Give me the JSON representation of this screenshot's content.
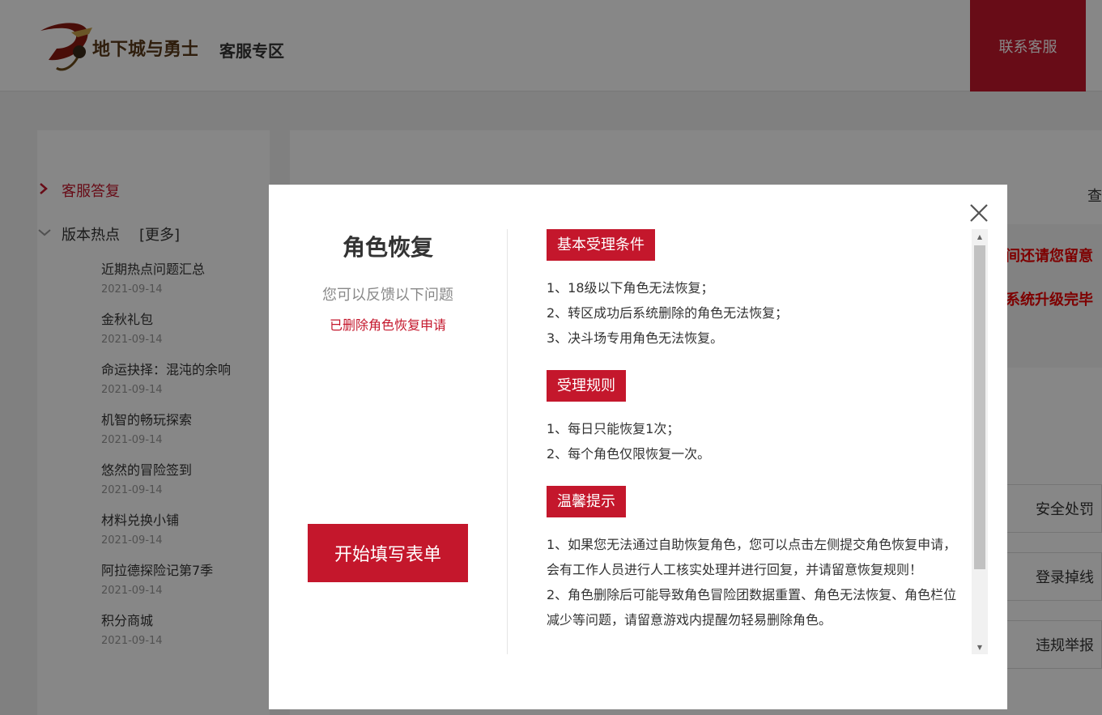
{
  "header": {
    "logo_text": "地下城与勇士",
    "site_title": "客服专区",
    "contact_label": "联系客服"
  },
  "sidebar": {
    "active_item": "客服答复",
    "hot_section": "版本热点",
    "more_label": "[更多]",
    "news": [
      {
        "title": "近期热点问题汇总",
        "date": "2021-09-14"
      },
      {
        "title": "金秋礼包",
        "date": "2021-09-14"
      },
      {
        "title": "命运抉择：混沌的余响",
        "date": "2021-09-14"
      },
      {
        "title": "机智的畅玩探索",
        "date": "2021-09-14"
      },
      {
        "title": "悠然的冒险签到",
        "date": "2021-09-14"
      },
      {
        "title": "材料兑换小铺",
        "date": "2021-09-14"
      },
      {
        "title": "阿拉德探险记第7季",
        "date": "2021-09-14"
      },
      {
        "title": "积分商城",
        "date": "2021-09-14"
      }
    ]
  },
  "background": {
    "search_peek": "查",
    "red_text_1": "间还请您留意",
    "red_text_2": "系统升级完毕",
    "categories": [
      "安全处罚",
      "登录掉线",
      "违规举报"
    ]
  },
  "modal": {
    "title": "角色恢复",
    "subtitle": "您可以反馈以下问题",
    "link": "已删除角色恢复申请",
    "start_button": "开始填写表单",
    "sections": [
      {
        "heading": "基本受理条件",
        "items": [
          "1、18级以下角色无法恢复；",
          "2、转区成功后系统删除的角色无法恢复；",
          "3、决斗场专用角色无法恢复。"
        ]
      },
      {
        "heading": "受理规则",
        "items": [
          "1、每日只能恢复1次；",
          "2、每个角色仅限恢复一次。"
        ]
      },
      {
        "heading": "温馨提示",
        "items": [
          "1、如果您无法通过自助恢复角色，您可以点击左侧提交角色恢复申请，会有工作人员进行人工核实处理并进行回复，并请留意恢复规则！",
          "2、角色删除后可能导致角色冒险团数据重置、角色无法恢复、角色栏位减少等问题，请留意游戏内提醒勿轻易删除角色。"
        ]
      }
    ]
  },
  "colors": {
    "brand_red": "#c4172c",
    "overlay": "rgba(0,0,0,0.47)"
  }
}
